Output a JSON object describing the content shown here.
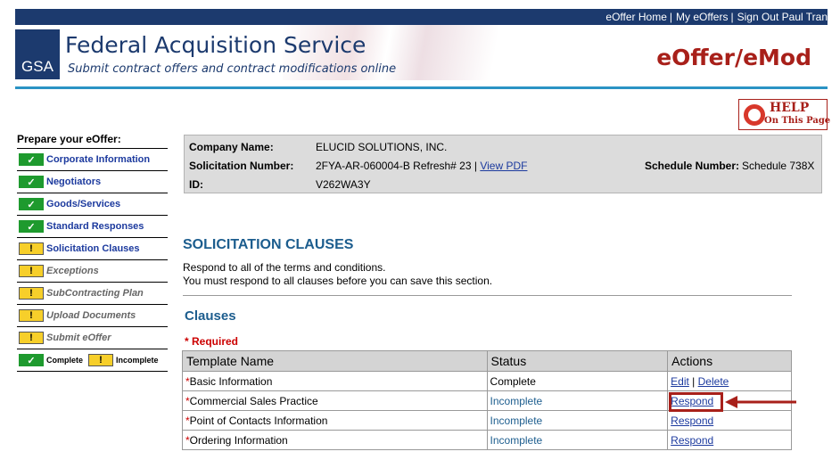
{
  "topnav": {
    "home": "eOffer Home",
    "my_eoffers": "My eOffers",
    "signout": "Sign Out Paul Tran"
  },
  "header": {
    "logo": "GSA",
    "title": "Federal Acquisition Service",
    "subtitle": "Submit contract offers and contract modifications online",
    "app_title": "eOffer/eMod"
  },
  "help": {
    "label": "HELP",
    "sub": "On This Page"
  },
  "sidebar": {
    "heading": "Prepare your eOffer:",
    "items": [
      {
        "label": "Corporate Information",
        "state": "complete",
        "icon": "check-icon"
      },
      {
        "label": "Negotiators",
        "state": "complete",
        "icon": "check-icon"
      },
      {
        "label": "Goods/Services",
        "state": "complete",
        "icon": "check-icon"
      },
      {
        "label": "Standard Responses",
        "state": "complete",
        "icon": "check-icon"
      },
      {
        "label": "Solicitation Clauses",
        "state": "current",
        "icon": "exclamation-icon"
      },
      {
        "label": "Exceptions",
        "state": "incomplete",
        "icon": "exclamation-icon"
      },
      {
        "label": "SubContracting Plan",
        "state": "incomplete",
        "icon": "exclamation-icon"
      },
      {
        "label": "Upload Documents",
        "state": "incomplete",
        "icon": "exclamation-icon"
      },
      {
        "label": "Submit eOffer",
        "state": "incomplete",
        "icon": "exclamation-icon"
      }
    ],
    "legend": {
      "complete": "Complete",
      "incomplete": "Incomplete"
    }
  },
  "company": {
    "name_label": "Company Name:",
    "name": "ELUCID SOLUTIONS, INC.",
    "solicitation_label": "Solicitation Number:",
    "solicitation": "2FYA-AR-060004-B Refresh# 23 |",
    "view_pdf": "View PDF",
    "schedule_label": "Schedule Number:",
    "schedule": "Schedule 738X",
    "id_label": "ID:",
    "id": "V262WA3Y"
  },
  "section": {
    "title": "SOLICITATION CLAUSES",
    "instructions": [
      "Respond to all of the terms and conditions.",
      "You must respond to all clauses before you can save this section."
    ],
    "clauses_title": "Clauses",
    "required_note": "* Required"
  },
  "table": {
    "headers": [
      "Template Name",
      "Status",
      "Actions"
    ],
    "rows": [
      {
        "name": "Basic Information",
        "status": "Complete",
        "actions": [
          "Edit",
          "Delete"
        ]
      },
      {
        "name": "Commercial Sales Practice",
        "status": "Incomplete",
        "actions": [
          "Respond"
        ]
      },
      {
        "name": "Point of Contacts Information",
        "status": "Incomplete",
        "actions": [
          "Respond"
        ]
      },
      {
        "name": "Ordering Information",
        "status": "Incomplete",
        "actions": [
          "Respond"
        ]
      }
    ]
  },
  "colors": {
    "navy": "#1c3a6e",
    "brand_red": "#a8201a",
    "accent_blue": "#2a93c4",
    "complete_green": "#1e9a2e",
    "incomplete_yellow": "#f7cf2a"
  }
}
